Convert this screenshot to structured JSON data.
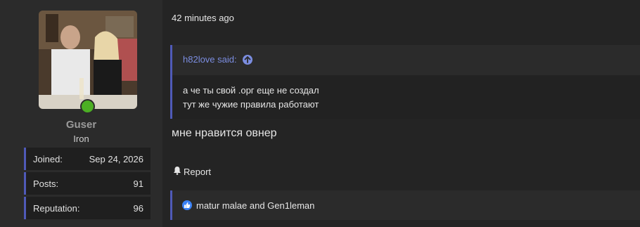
{
  "user": {
    "username": "Guser",
    "rank": "Iron",
    "stats": [
      {
        "label": "Joined:",
        "value": "Sep 24, 2026"
      },
      {
        "label": "Posts:",
        "value": "91"
      },
      {
        "label": "Reputation:",
        "value": "96"
      }
    ]
  },
  "post": {
    "time": "42 minutes ago",
    "quote": {
      "author_said": "h82love said:",
      "lines": [
        "а че ты свой .орг еще не создал",
        "тут же чужие правила работают"
      ]
    },
    "message": "мне нравится овнер",
    "report_label": "Report",
    "reactions_text": "matur malae and Gen1leman"
  },
  "colors": {
    "accent": "#4f5ab8",
    "quote_author": "#7b8de0",
    "online": "#4caf24",
    "like": "#3b82f6"
  }
}
